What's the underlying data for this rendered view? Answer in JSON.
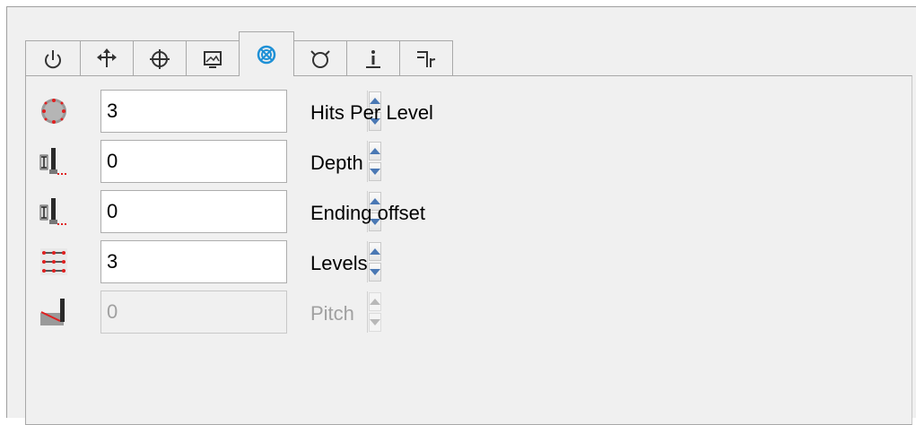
{
  "tabs": [
    {
      "icon": "power-icon",
      "active": false
    },
    {
      "icon": "move-arrows-icon",
      "active": false
    },
    {
      "icon": "crosshair-icon",
      "active": false
    },
    {
      "icon": "image-icon",
      "active": false
    },
    {
      "icon": "probe-pattern-icon",
      "active": true
    },
    {
      "icon": "circle-gauge-icon",
      "active": false
    },
    {
      "icon": "info-icon",
      "active": false
    },
    {
      "icon": "tool-path-icon",
      "active": false
    }
  ],
  "fields": [
    {
      "label": "Hits Per Level",
      "value": "3",
      "enabled": true,
      "icon": "hits-per-level-icon"
    },
    {
      "label": "Depth",
      "value": "0",
      "enabled": true,
      "icon": "depth-icon"
    },
    {
      "label": "Ending offset",
      "value": "0",
      "enabled": true,
      "icon": "ending-offset-icon"
    },
    {
      "label": "Levels",
      "value": "3",
      "enabled": true,
      "icon": "levels-icon"
    },
    {
      "label": "Pitch",
      "value": "0",
      "enabled": false,
      "icon": "pitch-icon"
    }
  ],
  "colors": {
    "accent": "#1e90d6",
    "probe_red": "#e02020",
    "disabled_text": "#a0a0a0"
  }
}
